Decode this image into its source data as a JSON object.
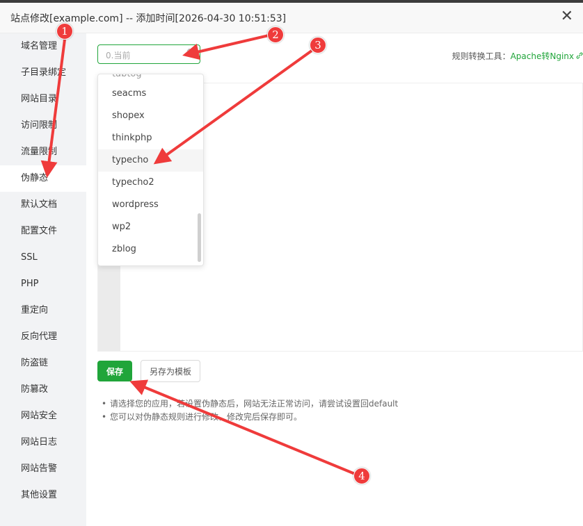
{
  "window": {
    "title": "站点修改[example.com] -- 添加时间[2026-04-30 10:51:53]",
    "close_glyph": "✕"
  },
  "sidebar": {
    "items": [
      {
        "label": "域名管理"
      },
      {
        "label": "子目录绑定"
      },
      {
        "label": "网站目录"
      },
      {
        "label": "访问限制"
      },
      {
        "label": "流量限制"
      },
      {
        "label": "伪静态",
        "active": true
      },
      {
        "label": "默认文档"
      },
      {
        "label": "配置文件"
      },
      {
        "label": "SSL"
      },
      {
        "label": "PHP"
      },
      {
        "label": "重定向"
      },
      {
        "label": "反向代理"
      },
      {
        "label": "防盗链"
      },
      {
        "label": "防篡改"
      },
      {
        "label": "网站安全"
      },
      {
        "label": "网站日志"
      },
      {
        "label": "网站告警"
      },
      {
        "label": "其他设置"
      }
    ]
  },
  "main": {
    "select": {
      "value": "0.当前",
      "caret_glyph": "^"
    },
    "tool": {
      "label": "规则转换工具：",
      "link": "Apache转Nginx",
      "icon": "link-icon"
    },
    "dropdown": {
      "options": [
        "typecho",
        "seacms",
        "shopex",
        "thinkphp",
        "typecho",
        "typecho2",
        "wordpress",
        "wp2",
        "zblog"
      ],
      "partial_top": "tabtog",
      "hovered_index": 3
    },
    "save_label": "保存",
    "template_label": "另存为模板",
    "tips": [
      "请选择您的应用，若设置伪静态后，网站无法正常访问，请尝试设置回default",
      "您可以对伪静态规则进行修改，修改完后保存即可。"
    ]
  },
  "annotations": {
    "badges": [
      "1",
      "2",
      "3",
      "4"
    ],
    "color": "#ef3b3b"
  },
  "colors": {
    "accent": "#20a53a",
    "annotation": "#ef3b3b"
  }
}
